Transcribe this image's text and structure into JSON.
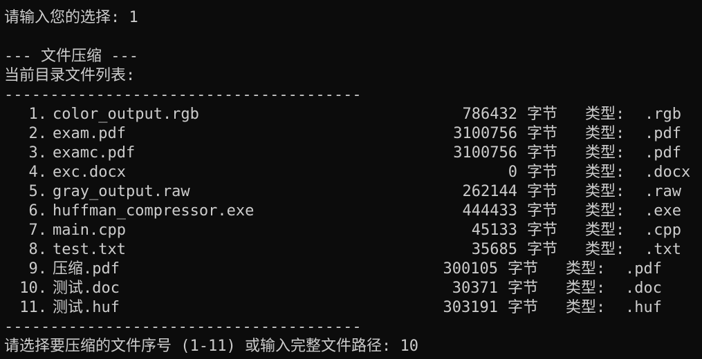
{
  "terminal": {
    "prompt_choice": "请输入您的选择: 1",
    "section_title": "--- 文件压缩 ---",
    "list_title": "当前目录文件列表:",
    "separator": "---------------------------------------",
    "files": [
      {
        "index": "1.",
        "name": "color_output.rgb",
        "size": "786432",
        "unit": "字节",
        "type_label": "类型:",
        "type": ".rgb"
      },
      {
        "index": "2.",
        "name": "exam.pdf",
        "size": "3100756",
        "unit": "字节",
        "type_label": "类型:",
        "type": ".pdf"
      },
      {
        "index": "3.",
        "name": "examc.pdf",
        "size": "3100756",
        "unit": "字节",
        "type_label": "类型:",
        "type": ".pdf"
      },
      {
        "index": "4.",
        "name": "exc.docx",
        "size": "0",
        "unit": "字节",
        "type_label": "类型:",
        "type": ".docx"
      },
      {
        "index": "5.",
        "name": "gray_output.raw",
        "size": "262144",
        "unit": "字节",
        "type_label": "类型:",
        "type": ".raw"
      },
      {
        "index": "6.",
        "name": "huffman_compressor.exe",
        "size": "444433",
        "unit": "字节",
        "type_label": "类型:",
        "type": ".exe"
      },
      {
        "index": "7.",
        "name": "main.cpp",
        "size": "45133",
        "unit": "字节",
        "type_label": "类型:",
        "type": ".cpp"
      },
      {
        "index": "8.",
        "name": "test.txt",
        "size": "35685",
        "unit": "字节",
        "type_label": "类型:",
        "type": ".txt"
      },
      {
        "index": "9.",
        "name": "压缩.pdf",
        "size": "300105",
        "unit": "字节",
        "type_label": "类型:",
        "type": ".pdf"
      },
      {
        "index": "10.",
        "name": "测试.doc",
        "size": "30371",
        "unit": "字节",
        "type_label": "类型:",
        "type": ".doc"
      },
      {
        "index": "11.",
        "name": "测试.huf",
        "size": "303191",
        "unit": "字节",
        "type_label": "类型:",
        "type": ".huf"
      }
    ],
    "select_prompt": "请选择要压缩的文件序号 (1-11) 或输入完整文件路径: 10"
  },
  "colors": {
    "background": "#0c0c0c",
    "foreground": "#cccccc"
  }
}
